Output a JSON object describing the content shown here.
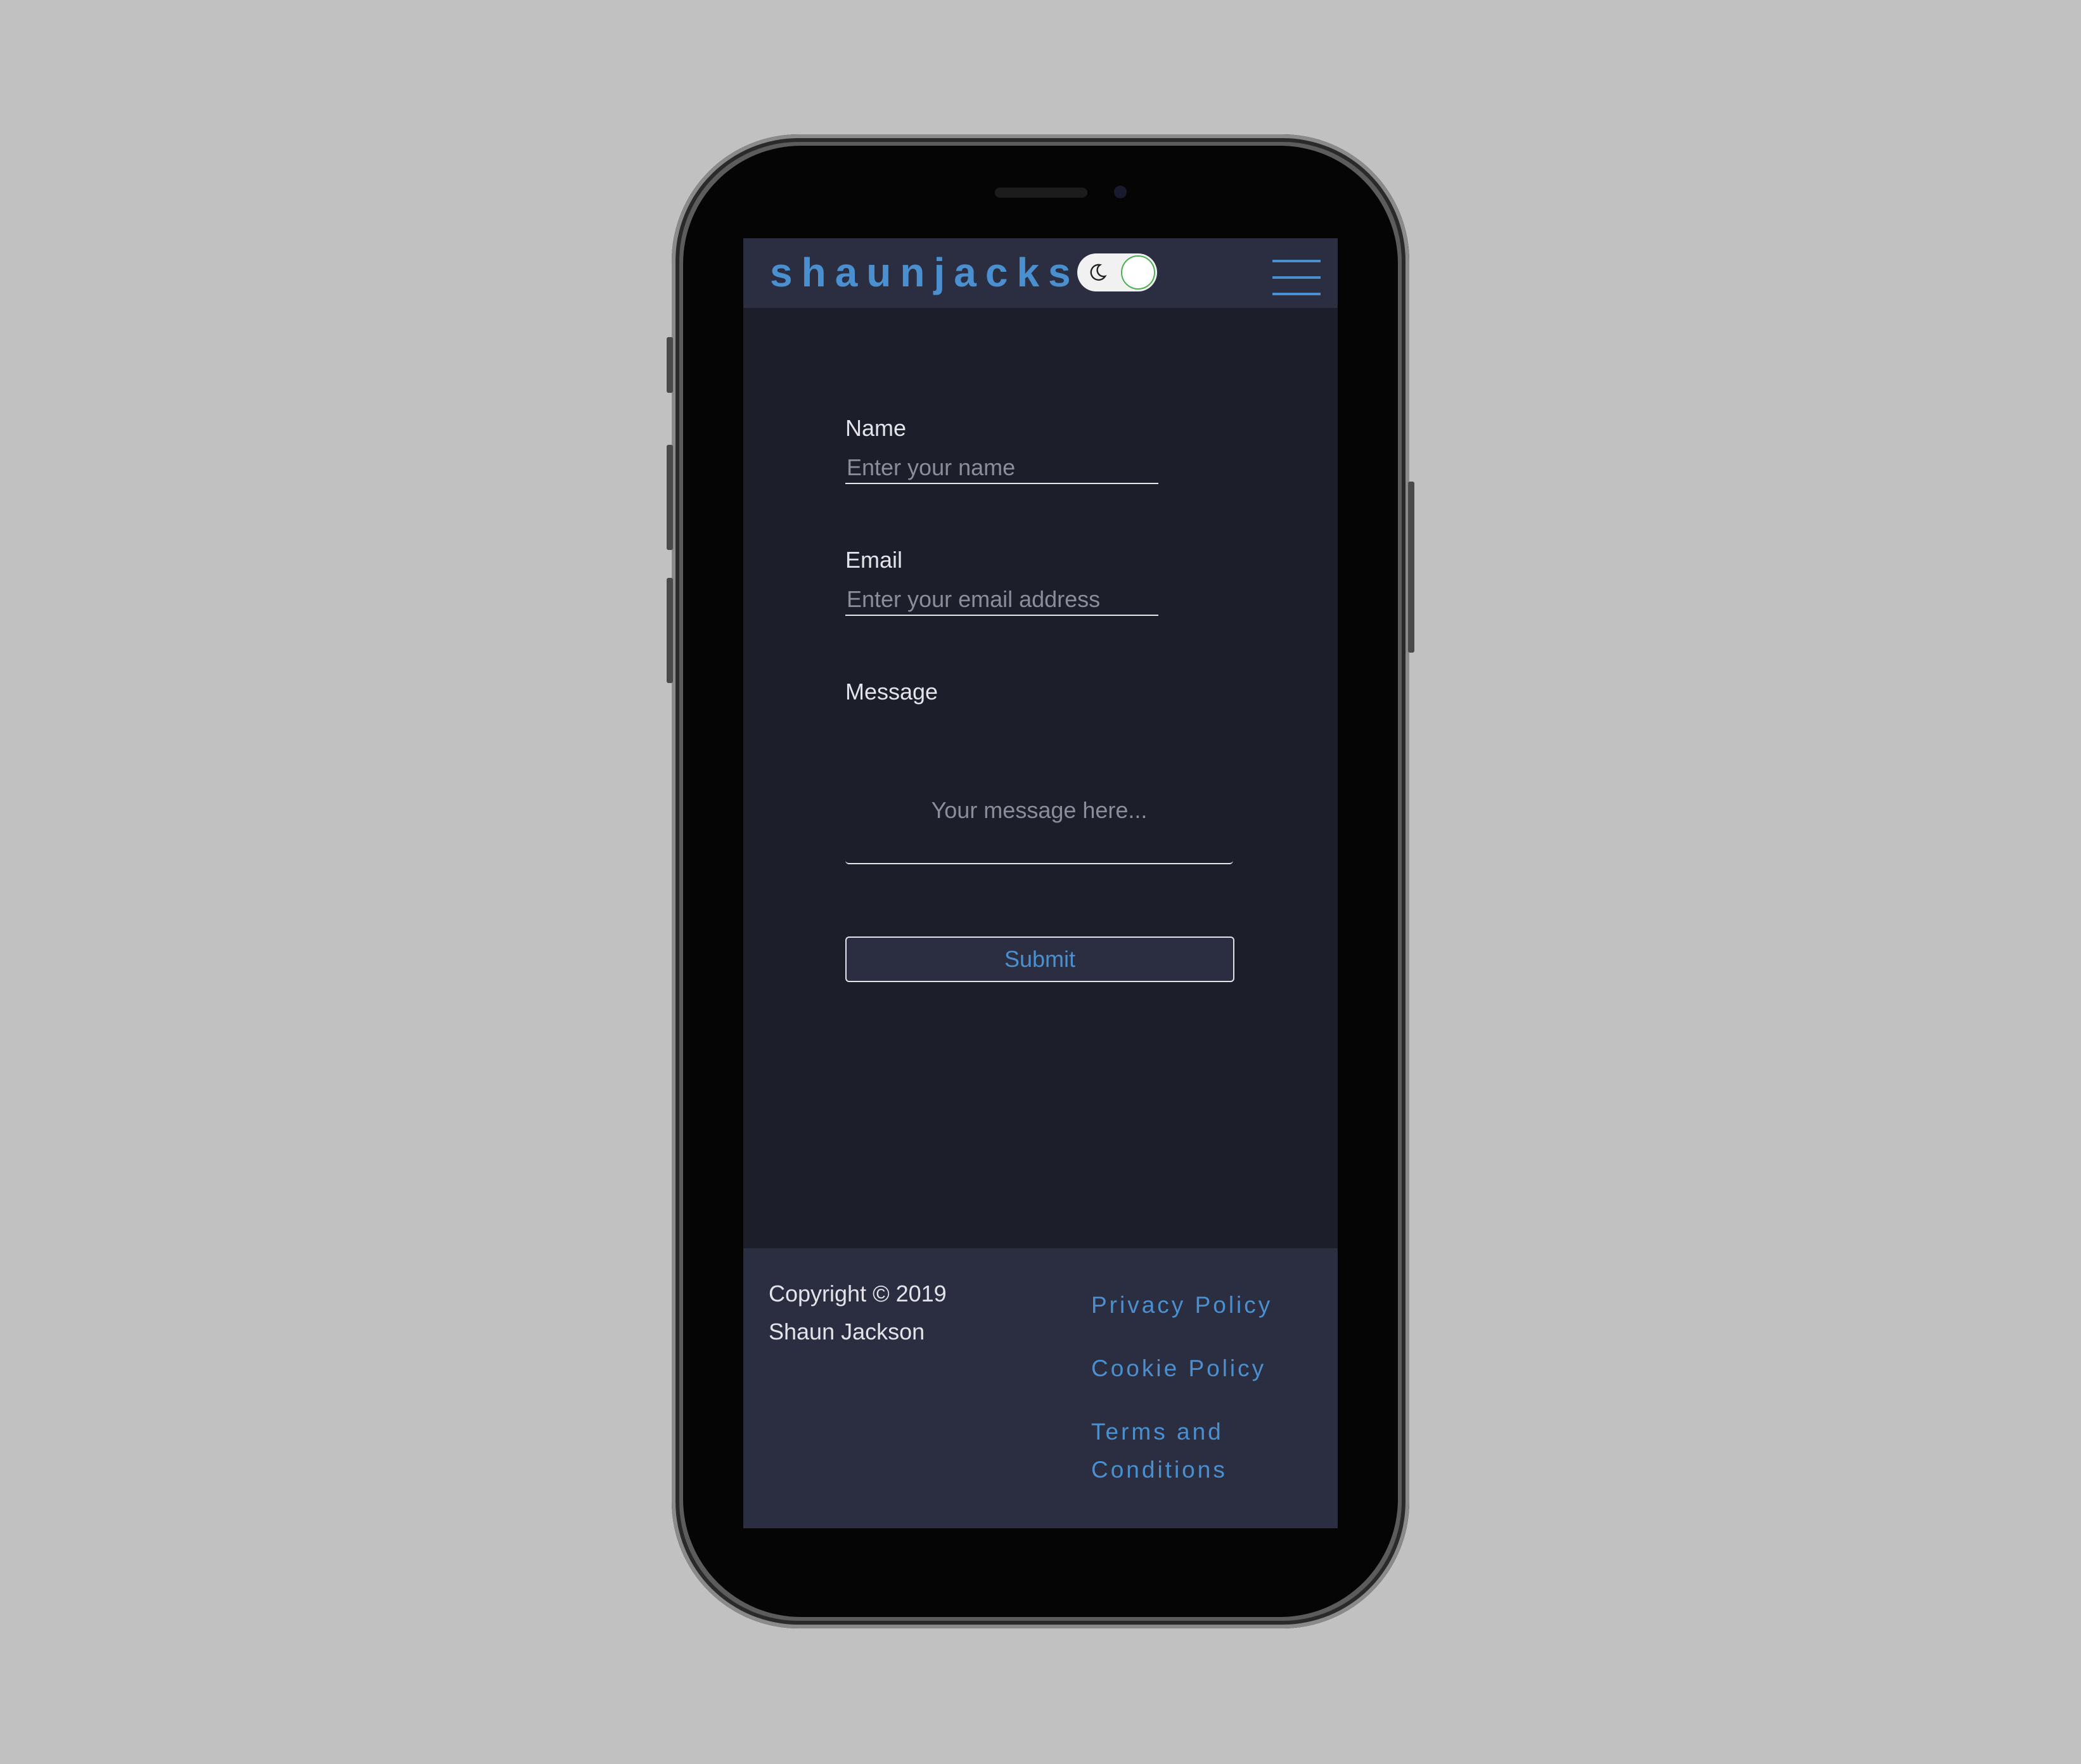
{
  "header": {
    "brand": "shaunjacks",
    "theme_toggle_state": "dark"
  },
  "form": {
    "name_label": "Name",
    "name_placeholder": "Enter your name",
    "email_label": "Email",
    "email_placeholder": "Enter your email address",
    "message_label": "Message",
    "message_placeholder": "Your message here...",
    "submit_label": "Submit"
  },
  "footer": {
    "copyright_line1": "Copyright © 2019",
    "copyright_line2": "Shaun Jackson",
    "links": [
      {
        "label": "Privacy Policy"
      },
      {
        "label": "Cookie Policy"
      },
      {
        "label": "Terms and Conditions"
      }
    ]
  },
  "colors": {
    "accent": "#4a90d0",
    "background": "#1c1e29",
    "surface": "#2b2e40",
    "text": "#e2e4ea",
    "toggle_border": "#4caf50"
  },
  "icons": {
    "theme": "moon-icon",
    "menu": "hamburger-menu-icon"
  }
}
